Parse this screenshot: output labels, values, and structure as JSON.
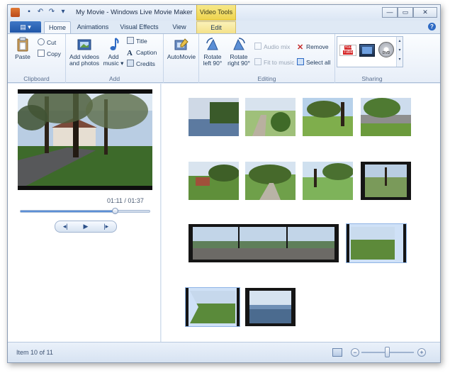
{
  "window": {
    "title": "My Movie - Windows Live Movie Maker",
    "context_group": "Video Tools",
    "controls": {
      "minimize": "—",
      "maximize": "▭",
      "close": "✕"
    }
  },
  "qat": {
    "save": "▪",
    "undo": "↶",
    "redo": "↷",
    "customize": "▾"
  },
  "tabs": {
    "file": "▤ ▾",
    "items": [
      {
        "label": "Home",
        "active": true
      },
      {
        "label": "Animations",
        "active": false
      },
      {
        "label": "Visual Effects",
        "active": false
      },
      {
        "label": "View",
        "active": false
      },
      {
        "label": "Edit",
        "active": false
      }
    ],
    "help": "?"
  },
  "ribbon": {
    "clipboard": {
      "label": "Clipboard",
      "paste": "Paste",
      "cut": "Cut",
      "copy": "Copy"
    },
    "add": {
      "label": "Add",
      "add_videos": "Add videos",
      "add_videos_2": "and photos",
      "add_music": "Add",
      "add_music_2": "music ▾",
      "title": "Title",
      "caption": "Caption",
      "credits": "Credits"
    },
    "automovie": {
      "label": "AutoMovie"
    },
    "editing": {
      "label": "Editing",
      "rotate_left": "Rotate",
      "rotate_left_2": "left 90°",
      "rotate_right": "Rotate",
      "rotate_right_2": "right 90°",
      "audio_mix": "Audio mix",
      "fit_to_music": "Fit to music",
      "remove": "Remove",
      "select_all": "Select all"
    },
    "sharing": {
      "label": "Sharing",
      "youtube": "You Tube",
      "dvd": "DVD"
    }
  },
  "preview": {
    "timecode": "01:11 / 01:37",
    "position_fraction": 0.73,
    "prev": "◂|",
    "play": "▶",
    "next": "|▸"
  },
  "status": {
    "item": "Item 10 of 11",
    "zoom_fraction": 0.5,
    "zoom_minus": "−",
    "zoom_plus": "+"
  },
  "colors": {
    "accent": "#2056a8",
    "context": "#eed44d",
    "selection": "#cfe1f7"
  }
}
